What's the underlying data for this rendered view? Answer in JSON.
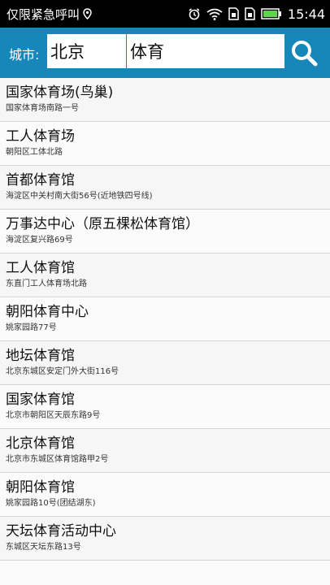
{
  "status_bar": {
    "carrier_text": "仅限紧急呼叫",
    "time": "15:44",
    "icons": [
      "location-icon",
      "alarm-icon",
      "wifi-icon",
      "sim-card-icon",
      "sim-card-icon",
      "battery-icon"
    ]
  },
  "search": {
    "city_label": "城市:",
    "city_value": "北京",
    "keyword_value": "体育",
    "search_icon": "search-icon"
  },
  "colors": {
    "header_bg": "#1687b8",
    "status_bg": "#000000",
    "battery": "#5fd34b"
  },
  "results": [
    {
      "title": "国家体育场(鸟巢)",
      "address": "国家体育场南路一号"
    },
    {
      "title": "工人体育场",
      "address": "朝阳区工体北路"
    },
    {
      "title": "首都体育馆",
      "address": "海淀区中关村南大街56号(近地铁四号线)"
    },
    {
      "title": "万事达中心（原五棵松体育馆）",
      "address": "海淀区复兴路69号"
    },
    {
      "title": "工人体育馆",
      "address": "东直门工人体育场北路"
    },
    {
      "title": "朝阳体育中心",
      "address": "姚家园路77号"
    },
    {
      "title": "地坛体育馆",
      "address": "北京东城区安定门外大街116号"
    },
    {
      "title": "国家体育馆",
      "address": "北京市朝阳区天辰东路9号"
    },
    {
      "title": "北京体育馆",
      "address": "北京市东城区体育馆路甲2号"
    },
    {
      "title": "朝阳体育馆",
      "address": "姚家园路10号(团结湖东)"
    },
    {
      "title": "天坛体育活动中心",
      "address": "东城区天坛东路13号"
    },
    {
      "title": "",
      "address": ""
    }
  ]
}
